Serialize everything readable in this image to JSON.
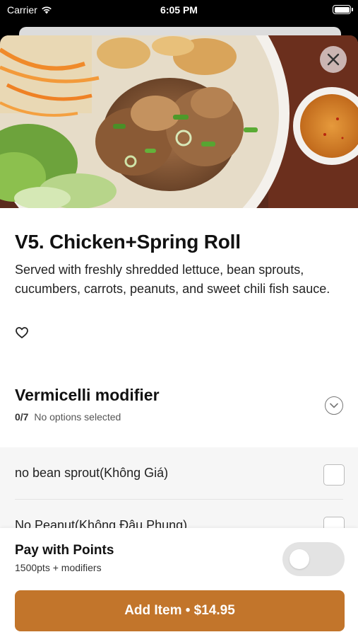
{
  "status_bar": {
    "carrier": "Carrier",
    "time": "6:05 PM"
  },
  "item": {
    "title": "V5. Chicken+Spring Roll",
    "description": "Served with freshly shredded lettuce, bean sprouts, cucumbers, carrots, peanuts, and sweet chili fish sauce."
  },
  "modifier": {
    "title": "Vermicelli modifier",
    "count": "0/7",
    "status": "No options selected",
    "options": [
      {
        "label": "no bean sprout(Không Giá)",
        "checked": false
      },
      {
        "label": "No Peanut(Không Đậu Phụng)",
        "checked": false
      }
    ]
  },
  "points": {
    "title": "Pay with Points",
    "subtitle": "1500pts + modifiers",
    "enabled": false
  },
  "add_button": {
    "label": "Add Item • $14.95"
  },
  "colors": {
    "accent": "#c2752b",
    "toggle_off": "#e3e3e3"
  },
  "icons": {
    "close": "close-icon",
    "favorite": "heart-outline-icon",
    "expand": "chevron-down-icon",
    "wifi": "wifi-icon",
    "battery": "battery-icon"
  }
}
